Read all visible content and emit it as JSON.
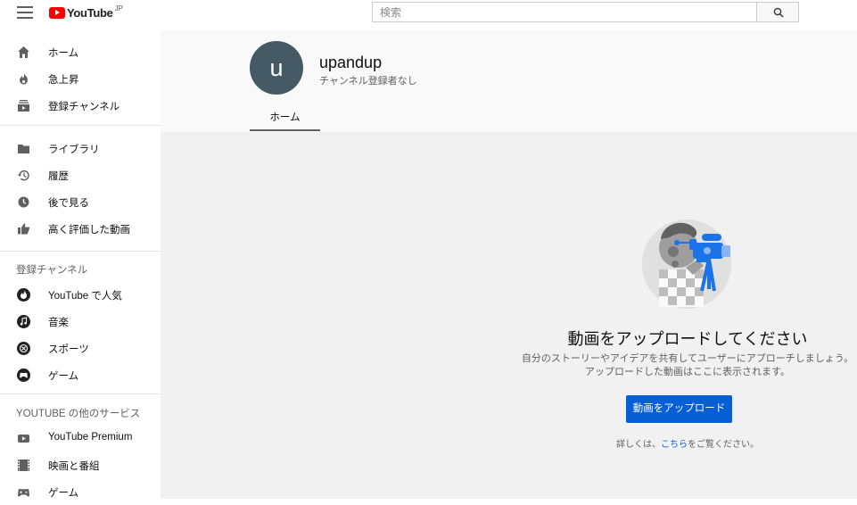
{
  "header": {
    "logo_text": "YouTube",
    "logo_region": "JP",
    "search": {
      "placeholder": "検索",
      "value": ""
    }
  },
  "sidebar": {
    "primary": [
      {
        "label": "ホーム",
        "icon": "home-icon"
      },
      {
        "label": "急上昇",
        "icon": "trending-icon"
      },
      {
        "label": "登録チャンネル",
        "icon": "subscriptions-icon"
      }
    ],
    "library": [
      {
        "label": "ライブラリ",
        "icon": "library-icon"
      },
      {
        "label": "履歴",
        "icon": "history-icon"
      },
      {
        "label": "後で見る",
        "icon": "watch-later-icon"
      },
      {
        "label": "高く評価した動画",
        "icon": "liked-videos-icon"
      }
    ],
    "subscriptions_title": "登録チャンネル",
    "subscriptions": [
      {
        "label": "YouTube で人気",
        "icon": "popular-icon"
      },
      {
        "label": "音楽",
        "icon": "music-icon"
      },
      {
        "label": "スポーツ",
        "icon": "sports-icon"
      },
      {
        "label": "ゲーム",
        "icon": "gaming-icon"
      }
    ],
    "more_title": "YOUTUBE の他のサービス",
    "more": [
      {
        "label": "YouTube Premium",
        "icon": "youtube-premium-icon"
      },
      {
        "label": "映画と番組",
        "icon": "movies-icon"
      },
      {
        "label": "ゲーム",
        "icon": "gaming-icon"
      }
    ]
  },
  "channel": {
    "avatar_letter": "u",
    "name": "upandup",
    "subscribers": "チャンネル登録者なし",
    "tabs": [
      {
        "label": "ホーム"
      }
    ]
  },
  "empty_state": {
    "title": "動画をアップロードしてください",
    "description_line1": "自分のストーリーやアイデアを共有してユーザーにアプローチしましょう。",
    "description_line2": "アップロードした動画はここに表示されます。",
    "upload_button": "動画をアップロード",
    "learn_more_prefix": "詳しくは、",
    "learn_more_link": "こちら",
    "learn_more_suffix": "をご覧ください。"
  },
  "colors": {
    "brand_red": "#ff0000",
    "accent_blue": "#065fd4",
    "avatar_bg": "#455a64"
  }
}
